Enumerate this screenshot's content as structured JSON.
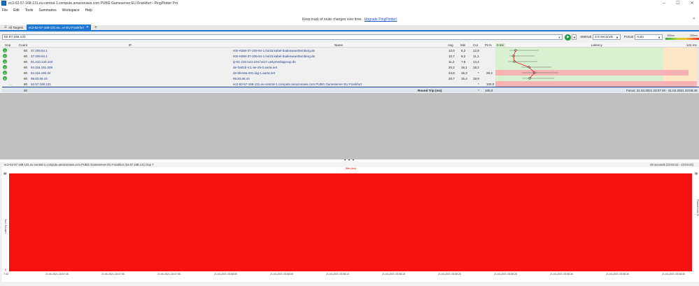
{
  "window": {
    "title": "ec2-52-57-168-131.eu-central-1.compute.amazonaws.com PUBG Gameserver EU Frankfurt - PingPlotter Pro"
  },
  "menu": [
    "File",
    "Edit",
    "Tools",
    "Summaries",
    "Workspace",
    "Help"
  ],
  "banner": {
    "text": "Keep track of route changes over time.",
    "link": "Upgrade PingPlotter!"
  },
  "tabs": {
    "all_targets": "All Targets",
    "active": "ec2-52-57-168-131.eu...er EU Frankfurt"
  },
  "toolbar": {
    "address": "52.57.168.131",
    "interval_label": "Interval",
    "interval_value": "2.5 seconds",
    "focus_label": "Focus",
    "focus_value": "Auto",
    "scale_low": "100ms",
    "scale_high": "200ms"
  },
  "columns": {
    "hop": "Hop",
    "count": "Count",
    "ip": "IP",
    "name": "Name",
    "avg": "Avg",
    "min": "Min",
    "cur": "Cur",
    "pl": "PL%",
    "lat_start": "0 ms",
    "latency": "Latency",
    "lat_end": "122 ms"
  },
  "hops": [
    {
      "hop": "1",
      "count": "60",
      "ip": "37.209.84.1",
      "name": "HSI-KBW-37-209-84-1.hsi15.kabel-badenwuerttemberg.de",
      "avg": "12,0",
      "min": "8,2",
      "cur": "12,8",
      "pl": ""
    },
    {
      "hop": "2",
      "count": "60",
      "ip": "37.209.84.1",
      "name": "HSI-KBW-37-209-84-1.hsi15.kabel-badenwuerttemberg.de",
      "avg": "10,7",
      "min": "8,2",
      "cur": "11,1",
      "pl": ""
    },
    {
      "hop": "3",
      "count": "60",
      "ip": "81.210.144.104",
      "name": "ip-81-210-144-104.hsi17.unitymediagroup.de",
      "avg": "11,2",
      "min": "7,8",
      "cur": "14,4",
      "pl": ""
    },
    {
      "hop": "4",
      "count": "60",
      "ip": "84.116.191.209",
      "name": "de-fra01b-rc1-ae-25-0.aorta.net",
      "avg": "20,2",
      "min": "16,1",
      "cur": "18,2",
      "pl": ""
    },
    {
      "hop": "5",
      "count": "60",
      "ip": "84.116.190.34",
      "name": "de-bfe18a-rt01-lag-1.aorta.net",
      "avg": "23,8",
      "min": "16,3",
      "cur": "*",
      "pl": "28,3"
    },
    {
      "hop": "6",
      "count": "60",
      "ip": "99.83.68.44",
      "name": "99.83.68.44",
      "avg": "20,7",
      "min": "16,4",
      "cur": "19,9",
      "pl": ""
    },
    {
      "hop": "...",
      "count": "60",
      "ip": "52.57.168.131",
      "name": "ec2-52-57-168-131.eu-central-1.compute.amazonaws.com PUBG Gameserver EU Frankfurt",
      "avg": "",
      "min": "",
      "cur": "*",
      "pl": "100,0"
    }
  ],
  "round_trip": {
    "count": "60",
    "label": "Round Trip (ms)",
    "cur": "*",
    "pl": "100,0",
    "focus": "Focus: 21.04.2021 23:07:40 - 21.04.2021 23:08:40"
  },
  "splitter_glyph": "• • •",
  "lower": {
    "title": "ec2-52-57-168-131.eu-central-1.compute.amazonaws.com PUBG Gameserver EU Frankfurt (52.57.168.131) hop 7",
    "range": "60 seconds (23:03:43 - 23:04:43)",
    "jitter_label": "Jitter (ms)",
    "y_left_top": "30",
    "y_right_top": "30",
    "y_left_label": "Latency (ms)",
    "y_right_label": "Packet Loss %",
    "y_left_mid": "10",
    "y_right_mid": "10",
    "y_left_zero": "0",
    "x_ticks": [
      "7:40",
      "21.04.2021 23:07:45",
      "21.04.2021 23:07:50",
      "21.04.2021 23:07:55",
      "21.04.2021 23:08:00",
      "21.04.2021 23:08:05",
      "21.04.2021 23:08:10",
      "21.04.2021 23:08:15",
      "21.04.2021 23:08:20",
      "21.04.2021 23:08:25",
      "21.04.2021 23:08:30",
      "21.04.2021 23:08:35",
      "21.04.2021 23:08:40"
    ]
  },
  "colors": {
    "accent": "#1f77d0",
    "packet_loss": "#f61111",
    "good": "#36a845"
  }
}
